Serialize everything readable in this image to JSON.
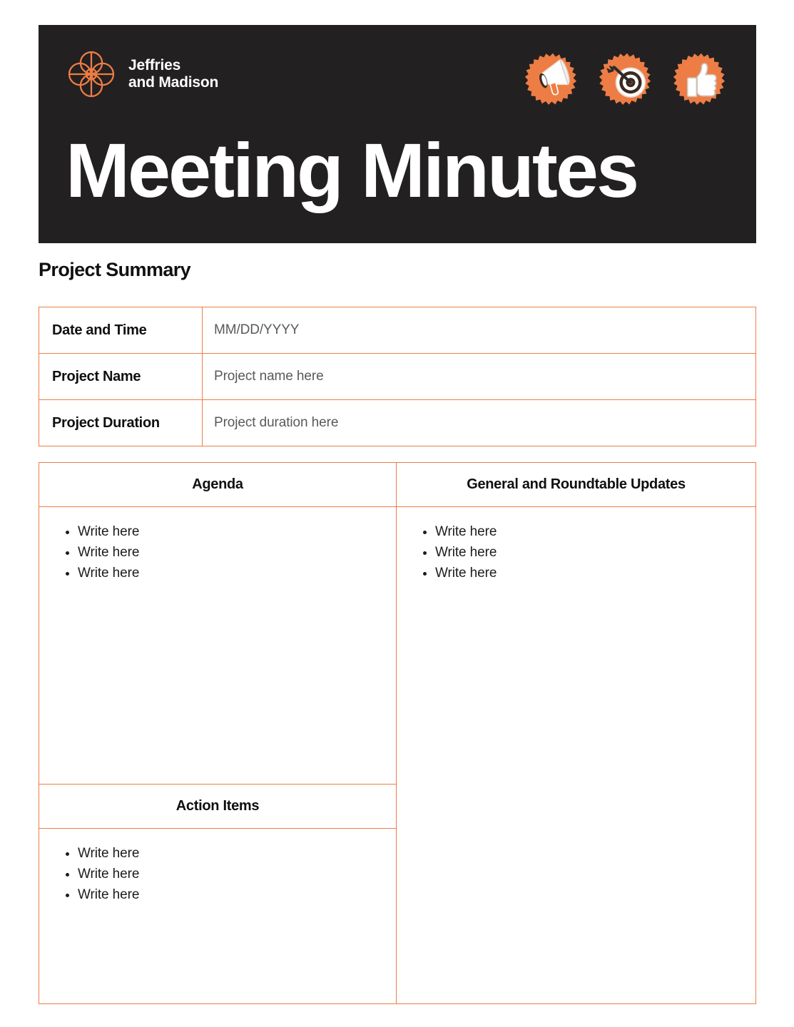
{
  "header": {
    "background_color": "#222021",
    "accent_color": "#ED7D45",
    "brand": {
      "logo_icon": "mandala-atom-logo",
      "name_line1": "Jeffries",
      "name_line2": "and Madison",
      "name": "Jeffries\nand Madison"
    },
    "badges": [
      {
        "icon": "megaphone-icon",
        "label": "Megaphone"
      },
      {
        "icon": "target-dart-icon",
        "label": "Target"
      },
      {
        "icon": "thumbs-up-icon",
        "label": "Thumbs Up"
      }
    ],
    "title": "Meeting Minutes"
  },
  "project_summary": {
    "heading": "Project Summary",
    "rows": [
      {
        "label": "Date and Time",
        "value": "MM/DD/YYYY"
      },
      {
        "label": "Project Name",
        "value": "Project name here"
      },
      {
        "label": "Project Duration",
        "value": "Project duration here"
      }
    ]
  },
  "panels": {
    "agenda": {
      "title": "Agenda",
      "items": [
        "Write here",
        "Write here",
        "Write here"
      ]
    },
    "action_items": {
      "title": "Action Items",
      "items": [
        "Write here",
        "Write here",
        "Write here"
      ]
    },
    "updates": {
      "title": "General and Roundtable Updates",
      "items": [
        "Write here",
        "Write here",
        "Write here"
      ]
    }
  }
}
